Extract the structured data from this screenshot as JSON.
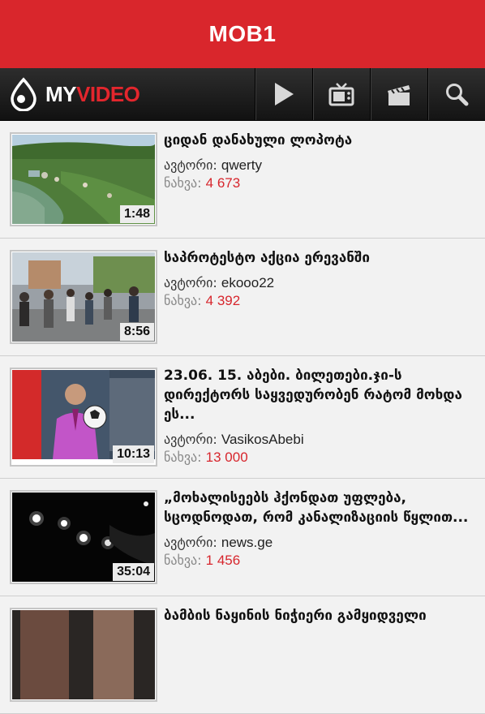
{
  "header": {
    "title": "MOB1"
  },
  "nav": {
    "logo_my": "MY",
    "logo_video": "VIDEO",
    "buttons": [
      "play-icon",
      "tv-icon",
      "clapperboard-icon",
      "search-icon"
    ]
  },
  "labels": {
    "author": "ავტორი:",
    "views": "ნახვა:"
  },
  "videos": [
    {
      "title": "ციდან დანახული ლოპოტა",
      "author": "qwerty",
      "views": "4 673",
      "duration": "1:48"
    },
    {
      "title": "საპროტესტო აქცია ერევანში",
      "author": "ekooo22",
      "views": "4 392",
      "duration": "8:56"
    },
    {
      "title": "23.06. 15. აბები. ბილეთები.ჯი-ს დირექტორს საყვედურობენ რატომ მოხდა ეს...",
      "author": "VasikosAbebi",
      "views": "13 000",
      "duration": "10:13"
    },
    {
      "title": "„მოხალისეებს ჰქონდათ უფლება, სცოდნოდათ, რომ კანალიზაციის წყლით...",
      "author": "news.ge",
      "views": "1 456",
      "duration": "35:04"
    },
    {
      "title": "ბამბის ნაყინის ნიჭიერი გამყიდველი",
      "author": "",
      "views": "",
      "duration": ""
    }
  ],
  "colors": {
    "accent": "#d9262c",
    "views": "#d7262d"
  }
}
